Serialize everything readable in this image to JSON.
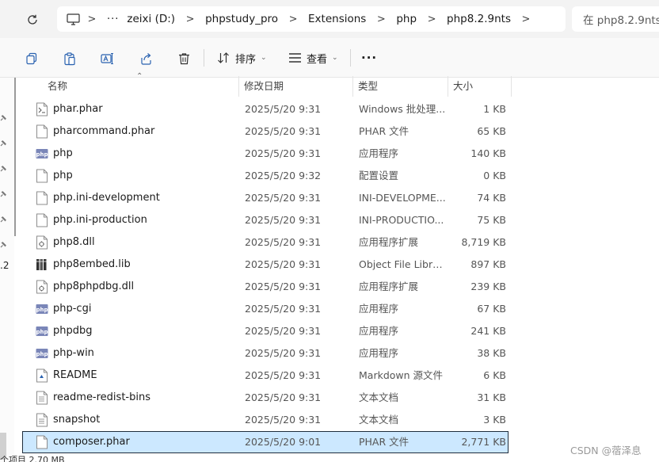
{
  "address": {
    "crumbs": [
      "zeixi (D:)",
      "phpstudy_pro",
      "Extensions",
      "php",
      "php8.2.9nts"
    ],
    "ellipsis": "···",
    "separator": ">",
    "search_placeholder": "在 php8.2.9nts"
  },
  "toolbar": {
    "sort_label": "排序",
    "view_label": "查看",
    "more_label": "···"
  },
  "left_pane": {
    "partial_text": ".2"
  },
  "columns": {
    "name": "名称",
    "date": "修改日期",
    "type": "类型",
    "size": "大小"
  },
  "files": [
    {
      "name": "phar.phar",
      "date": "2025/5/20 9:31",
      "type": "Windows 批处理...",
      "size": "1 KB",
      "icon": "batch-file-icon"
    },
    {
      "name": "pharcommand.phar",
      "date": "2025/5/20 9:31",
      "type": "PHAR 文件",
      "size": "65 KB",
      "icon": "blank-file-icon"
    },
    {
      "name": "php",
      "date": "2025/5/20 9:31",
      "type": "应用程序",
      "size": "140 KB",
      "icon": "php-exe-icon"
    },
    {
      "name": "php",
      "date": "2025/5/20 9:32",
      "type": "配置设置",
      "size": "0 KB",
      "icon": "blank-file-icon"
    },
    {
      "name": "php.ini-development",
      "date": "2025/5/20 9:31",
      "type": "INI-DEVELOPME...",
      "size": "74 KB",
      "icon": "blank-file-icon"
    },
    {
      "name": "php.ini-production",
      "date": "2025/5/20 9:31",
      "type": "INI-PRODUCTIO...",
      "size": "75 KB",
      "icon": "blank-file-icon"
    },
    {
      "name": "php8.dll",
      "date": "2025/5/20 9:31",
      "type": "应用程序扩展",
      "size": "8,719 KB",
      "icon": "dll-file-icon"
    },
    {
      "name": "php8embed.lib",
      "date": "2025/5/20 9:31",
      "type": "Object File Library",
      "size": "897 KB",
      "icon": "lib-file-icon"
    },
    {
      "name": "php8phpdbg.dll",
      "date": "2025/5/20 9:31",
      "type": "应用程序扩展",
      "size": "239 KB",
      "icon": "dll-file-icon"
    },
    {
      "name": "php-cgi",
      "date": "2025/5/20 9:31",
      "type": "应用程序",
      "size": "67 KB",
      "icon": "php-exe-icon"
    },
    {
      "name": "phpdbg",
      "date": "2025/5/20 9:31",
      "type": "应用程序",
      "size": "241 KB",
      "icon": "php-exe-icon"
    },
    {
      "name": "php-win",
      "date": "2025/5/20 9:31",
      "type": "应用程序",
      "size": "38 KB",
      "icon": "php-exe-icon"
    },
    {
      "name": "README",
      "date": "2025/5/20 9:31",
      "type": "Markdown 源文件",
      "size": "6 KB",
      "icon": "markdown-file-icon"
    },
    {
      "name": "readme-redist-bins",
      "date": "2025/5/20 9:31",
      "type": "文本文档",
      "size": "31 KB",
      "icon": "text-file-icon"
    },
    {
      "name": "snapshot",
      "date": "2025/5/20 9:31",
      "type": "文本文档",
      "size": "3 KB",
      "icon": "text-file-icon"
    },
    {
      "name": "composer.phar",
      "date": "2025/5/20 9:01",
      "type": "PHAR 文件",
      "size": "2,771 KB",
      "icon": "blank-file-icon",
      "selected": true
    }
  ],
  "status": {
    "text": "个项目  2.70 MB"
  },
  "watermark": "CSDN @蓿泽息",
  "colors": {
    "selected_bg": "#cce8ff",
    "selected_border": "#1f2e3d",
    "php_icon": "#7a86b8"
  }
}
